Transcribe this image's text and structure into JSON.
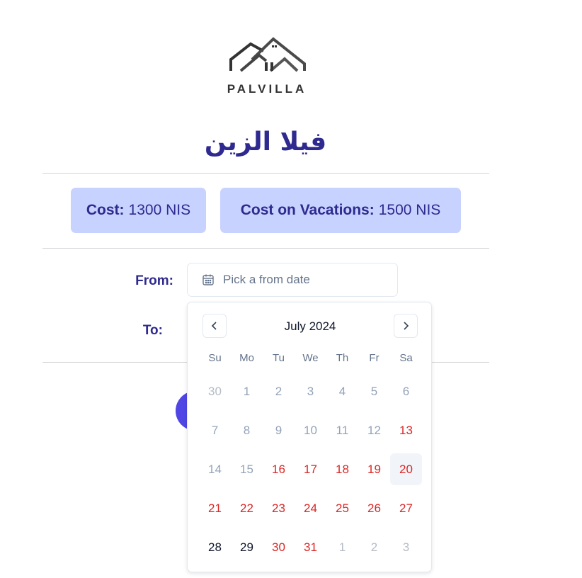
{
  "brand": {
    "name": "PALVILLA"
  },
  "villa": {
    "title": "فيلا الزين"
  },
  "pricing": {
    "cost_label": "Cost:",
    "cost_value": "1300 NIS",
    "vacation_label": "Cost on Vacations:",
    "vacation_value": "1500 NIS"
  },
  "form": {
    "from_label": "From:",
    "to_label": "To:",
    "from_placeholder": "Pick a from date"
  },
  "calendar": {
    "month": "July 2024",
    "weekdays": [
      "Su",
      "Mo",
      "Tu",
      "We",
      "Th",
      "Fr",
      "Sa"
    ],
    "weeks": [
      [
        {
          "d": "30",
          "s": "outside"
        },
        {
          "d": "1",
          "s": "muted"
        },
        {
          "d": "2",
          "s": "muted"
        },
        {
          "d": "3",
          "s": "muted"
        },
        {
          "d": "4",
          "s": "muted"
        },
        {
          "d": "5",
          "s": "muted"
        },
        {
          "d": "6",
          "s": "muted"
        }
      ],
      [
        {
          "d": "7",
          "s": "muted"
        },
        {
          "d": "8",
          "s": "muted"
        },
        {
          "d": "9",
          "s": "muted"
        },
        {
          "d": "10",
          "s": "muted"
        },
        {
          "d": "11",
          "s": "muted"
        },
        {
          "d": "12",
          "s": "muted"
        },
        {
          "d": "13",
          "s": "booked"
        }
      ],
      [
        {
          "d": "14",
          "s": "muted"
        },
        {
          "d": "15",
          "s": "muted"
        },
        {
          "d": "16",
          "s": "booked"
        },
        {
          "d": "17",
          "s": "booked"
        },
        {
          "d": "18",
          "s": "booked"
        },
        {
          "d": "19",
          "s": "booked"
        },
        {
          "d": "20",
          "s": "booked today"
        }
      ],
      [
        {
          "d": "21",
          "s": "booked"
        },
        {
          "d": "22",
          "s": "booked"
        },
        {
          "d": "23",
          "s": "booked"
        },
        {
          "d": "24",
          "s": "booked"
        },
        {
          "d": "25",
          "s": "booked"
        },
        {
          "d": "26",
          "s": "booked"
        },
        {
          "d": "27",
          "s": "booked"
        }
      ],
      [
        {
          "d": "28",
          "s": "available"
        },
        {
          "d": "29",
          "s": "available"
        },
        {
          "d": "30",
          "s": "booked"
        },
        {
          "d": "31",
          "s": "booked"
        },
        {
          "d": "1",
          "s": "outside"
        },
        {
          "d": "2",
          "s": "outside"
        },
        {
          "d": "3",
          "s": "outside"
        }
      ]
    ],
    "icons": {
      "prev": "chevron-left-icon",
      "next": "chevron-right-icon",
      "calendar": "calendar-icon"
    }
  },
  "colors": {
    "accent": "#2e2a8f",
    "price_box_bg": "#c7d2fe",
    "booked": "#dc2626",
    "button": "#4f46e5"
  }
}
